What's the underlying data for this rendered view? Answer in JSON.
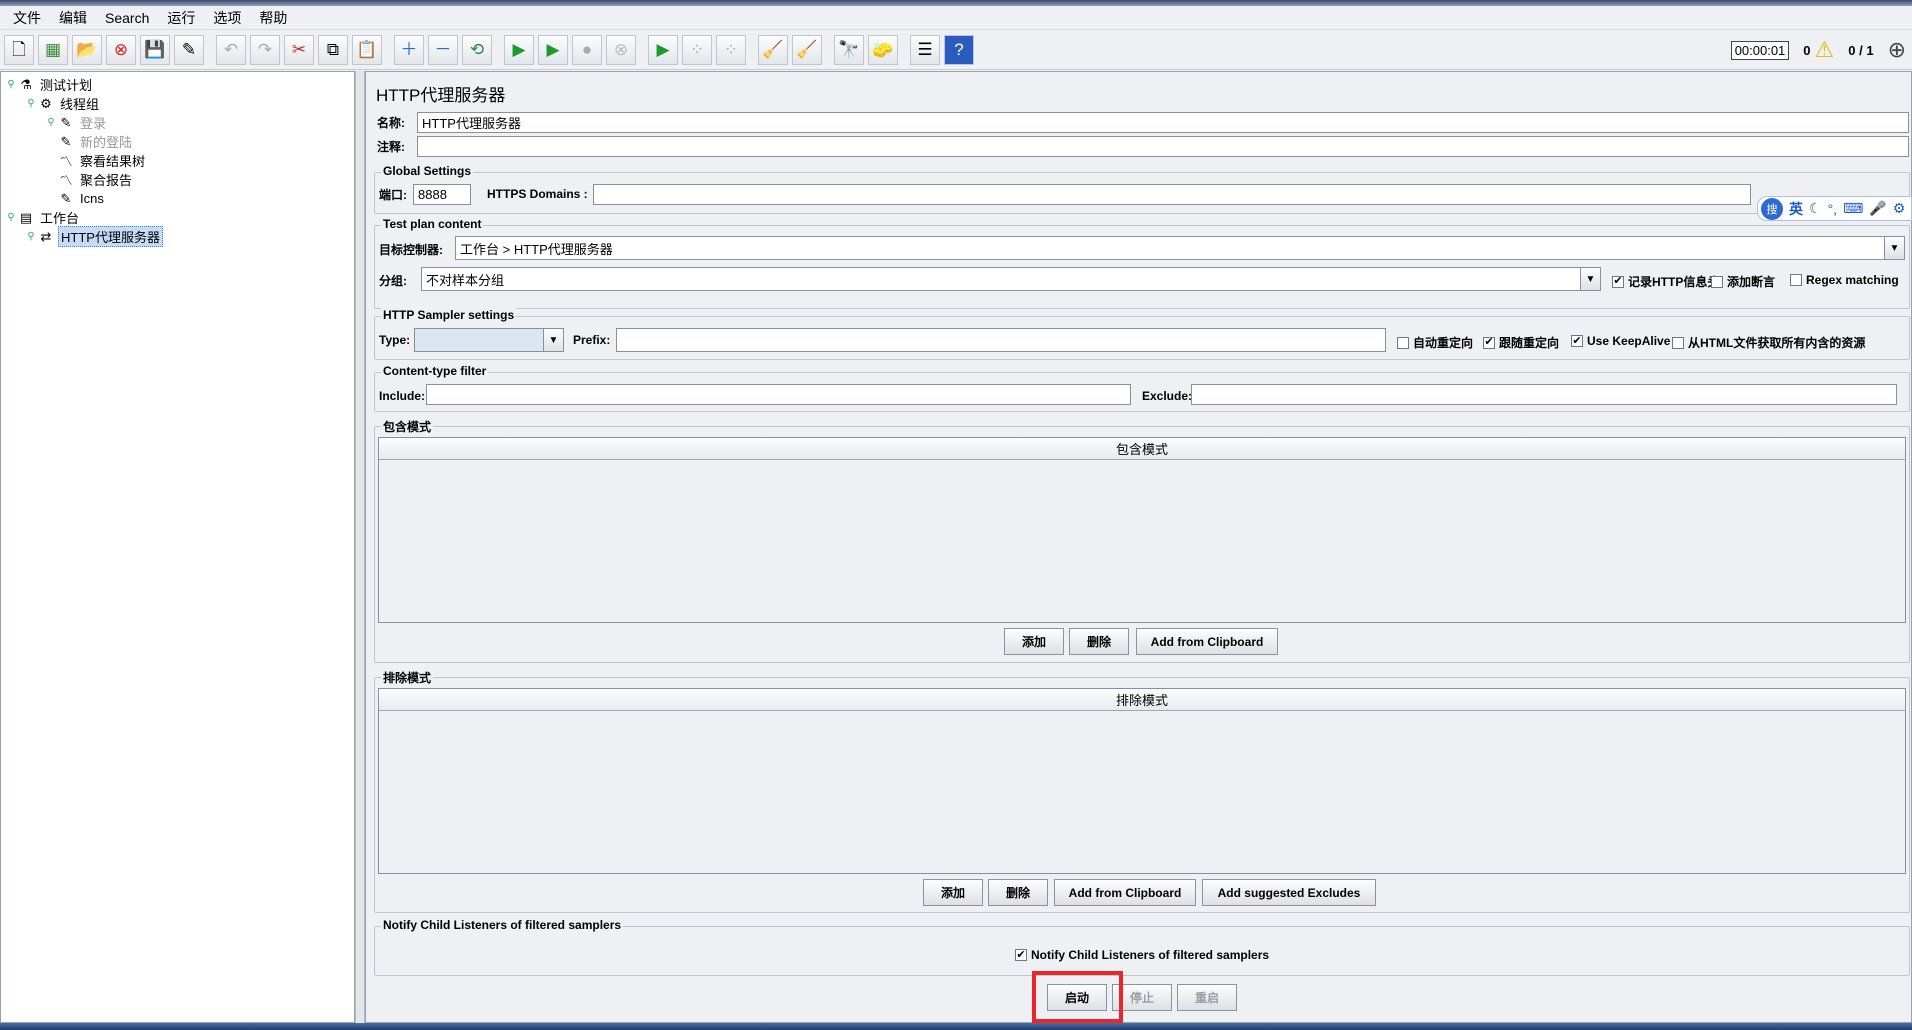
{
  "menu": [
    "文件",
    "编辑",
    "Search",
    "运行",
    "选项",
    "帮助"
  ],
  "toolbar": {
    "timer": "00:00:01",
    "warning_count": "0",
    "thread_count": "0 / 1"
  },
  "tree": [
    {
      "label": "测试计划",
      "icon": "test-plan-icon",
      "toggle": "o",
      "level": 0
    },
    {
      "label": "线程组",
      "icon": "gear-icon",
      "toggle": "o",
      "level": 1
    },
    {
      "label": "登录",
      "icon": "pen-icon",
      "toggle": "o",
      "level": 2,
      "disabled": true
    },
    {
      "label": "新的登陆",
      "icon": "pen-icon",
      "toggle": "",
      "level": 2,
      "disabled": true
    },
    {
      "label": "察看结果树",
      "icon": "chart-icon",
      "toggle": "",
      "level": 2
    },
    {
      "label": "聚合报告",
      "icon": "chart-icon",
      "toggle": "",
      "level": 2
    },
    {
      "label": "Icns",
      "icon": "pen-icon",
      "toggle": "",
      "level": 2
    },
    {
      "label": "工作台",
      "icon": "workbench-icon",
      "toggle": "o",
      "level": 0
    },
    {
      "label": "HTTP代理服务器",
      "icon": "proxy-icon",
      "toggle": "o",
      "level": 1,
      "selected": true
    }
  ],
  "panel": {
    "title": "HTTP代理服务器",
    "name_label": "名称:",
    "name_value": "HTTP代理服务器",
    "comment_label": "注释:",
    "comment_value": ""
  },
  "global_settings": {
    "legend": "Global Settings",
    "port_label": "端口:",
    "port_value": "8888",
    "https_label": "HTTPS Domains :",
    "https_value": ""
  },
  "test_plan_content": {
    "legend": "Test plan content",
    "target_label": "目标控制器:",
    "target_value": "工作台 > HTTP代理服务器",
    "group_label": "分组:",
    "group_value": "不对样本分组",
    "checkboxes": [
      {
        "label": "记录HTTP信息头",
        "checked": true
      },
      {
        "label": "添加断言",
        "checked": false
      },
      {
        "label": "Regex matching",
        "checked": false
      }
    ]
  },
  "sampler_settings": {
    "legend": "HTTP Sampler settings",
    "type_label": "Type:",
    "type_value": "",
    "prefix_label": "Prefix:",
    "prefix_value": "",
    "checkboxes": [
      {
        "label": "自动重定向",
        "checked": false
      },
      {
        "label": "跟随重定向",
        "checked": true
      },
      {
        "label": "Use KeepAlive",
        "checked": true
      },
      {
        "label": "从HTML文件获取所有内含的资源",
        "checked": false
      }
    ]
  },
  "content_filter": {
    "legend": "Content-type filter",
    "include_label": "Include:",
    "include_value": "",
    "exclude_label": "Exclude:",
    "exclude_value": ""
  },
  "include_patterns": {
    "legend": "包含模式",
    "column": "包含模式",
    "buttons": [
      "添加",
      "删除",
      "Add from Clipboard"
    ]
  },
  "exclude_patterns": {
    "legend": "排除模式",
    "column": "排除模式",
    "buttons": [
      "添加",
      "删除",
      "Add from Clipboard",
      "Add suggested Excludes"
    ]
  },
  "notify": {
    "legend": "Notify Child Listeners of filtered samplers",
    "checkbox_label": "Notify Child Listeners of filtered samplers",
    "checked": true
  },
  "actions": {
    "start": "启动",
    "stop": "停止",
    "restart": "重启"
  },
  "ime": {
    "logo": "搜",
    "lang": "英"
  },
  "colors": {
    "highlight": "#e8262b",
    "selection": "#c6dbf5"
  }
}
